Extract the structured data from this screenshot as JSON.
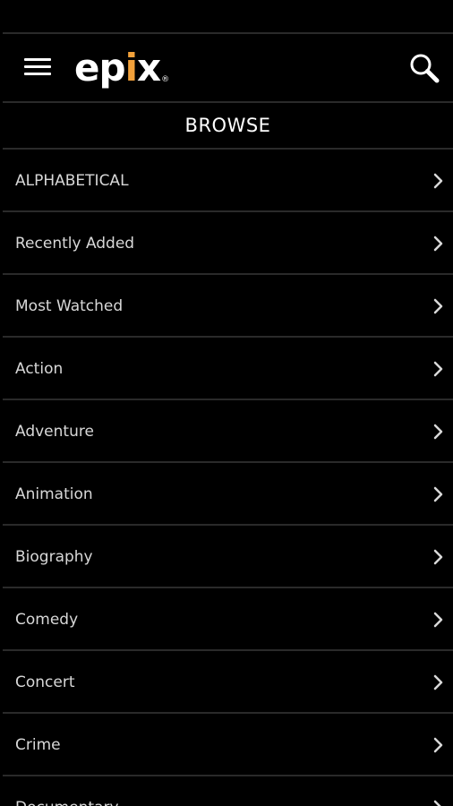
{
  "header": {
    "logo_text": "epix",
    "logo_reg": "®",
    "menu_icon": "hamburger-icon",
    "search_icon": "search-icon"
  },
  "browse": {
    "title": "BROWSE",
    "items": [
      {
        "label": "ALPHABETICAL"
      },
      {
        "label": "Recently Added"
      },
      {
        "label": "Most Watched"
      },
      {
        "label": "Action"
      },
      {
        "label": "Adventure"
      },
      {
        "label": "Animation"
      },
      {
        "label": "Biography"
      },
      {
        "label": "Comedy"
      },
      {
        "label": "Concert"
      },
      {
        "label": "Crime"
      },
      {
        "label": "Documentary"
      }
    ]
  },
  "colors": {
    "background": "#000000",
    "divider": "#2a2a2a",
    "logo_accent": "#f2a13a",
    "text": "#d8d8d8"
  }
}
